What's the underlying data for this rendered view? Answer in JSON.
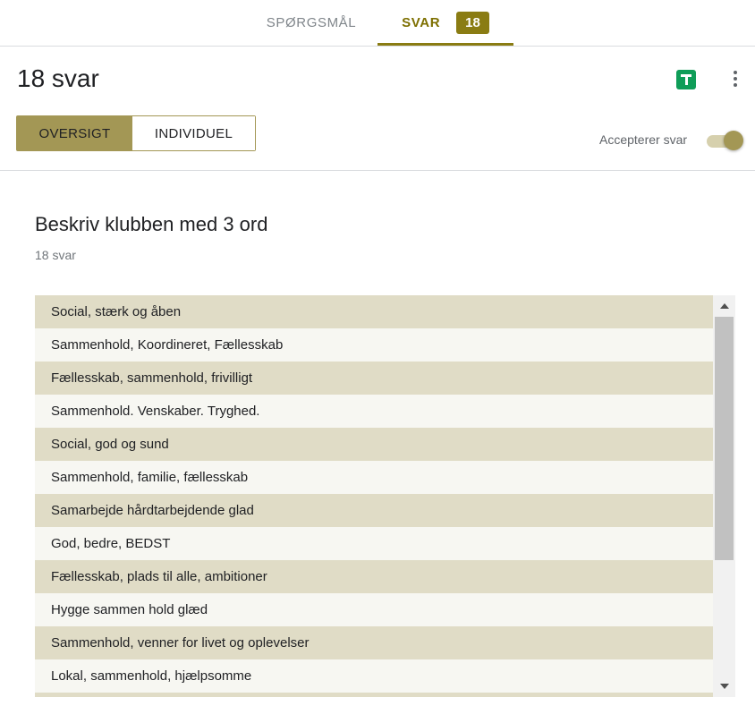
{
  "top_tabs": {
    "questions_label": "SPØRGSMÅL",
    "responses_label": "SVAR",
    "responses_count": "18"
  },
  "header": {
    "title": "18 svar",
    "view_summary_label": "OVERSIGT",
    "view_individual_label": "INDIVIDUEL",
    "accepting_label": "Accepterer svar",
    "accepting_on": true
  },
  "question": {
    "title": "Beskriv klubben med 3 ord",
    "count": "18 svar",
    "answers": [
      "Social, stærk og åben",
      "Sammenhold, Koordineret, Fællesskab",
      "Fællesskab, sammenhold, frivilligt",
      "Sammenhold. Venskaber. Tryghed.",
      "Social, god og sund",
      "Sammenhold, familie, fællesskab",
      "Samarbejde hårdtarbejdende glad",
      "God, bedre, BEDST",
      "Fællesskab, plads til alle, ambitioner",
      "Hygge sammen hold glæd",
      "Sammenhold, venner for livet og oplevelser",
      "Lokal, sammenhold, hjælpsomme"
    ]
  },
  "colors": {
    "accent": "#8a7c13",
    "button_active": "#a39755",
    "row_odd": "#e0dcc6",
    "row_even": "#f7f7f2",
    "sheets_green": "#0f9d58"
  },
  "icons": {
    "sheets": "google-sheets-icon",
    "more": "more-vert-icon"
  }
}
